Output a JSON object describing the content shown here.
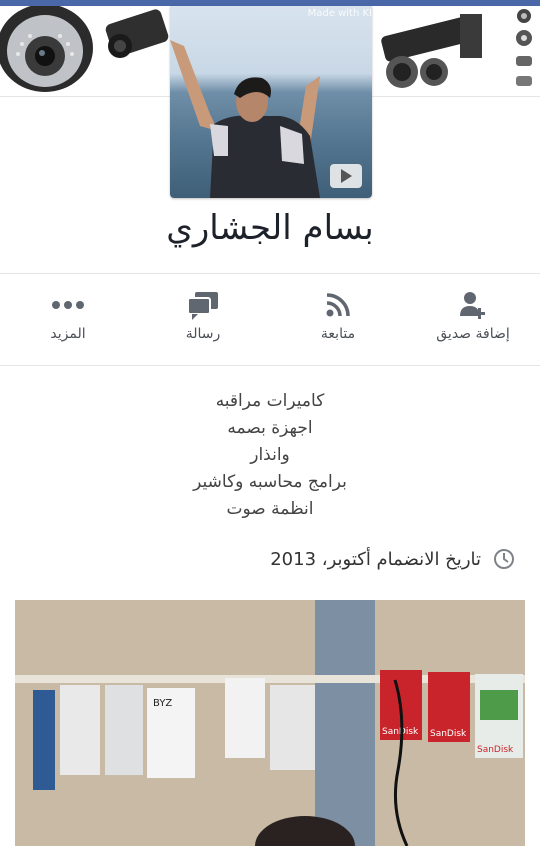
{
  "profile": {
    "name": "بسام الجشاري",
    "watermark": "Made with KI",
    "play_icon": "play-icon"
  },
  "actions": [
    {
      "label": "إضافة صديق",
      "icon": "add-friend-icon"
    },
    {
      "label": "متابعة",
      "icon": "follow-rss-icon"
    },
    {
      "label": "رسالة",
      "icon": "message-icon"
    },
    {
      "label": "المزيد",
      "icon": "more-dots-icon"
    }
  ],
  "bio": {
    "lines": [
      "كاميرات مراقبه",
      "اجهزة بصمه",
      "وانذار",
      "برامج محاسبه وكاشير",
      "انظمة صوت"
    ]
  },
  "joined": {
    "text": "تاريخ الانضمام أكتوبر، 2013",
    "icon": "clock-icon"
  },
  "photo": {
    "labels": [
      "BYZ",
      "SanDisk",
      "SanDisk",
      "SanDisk"
    ]
  },
  "colors": {
    "top_bar": "#4a67a8",
    "icon_gray": "#616770",
    "name": "#1d2129"
  }
}
